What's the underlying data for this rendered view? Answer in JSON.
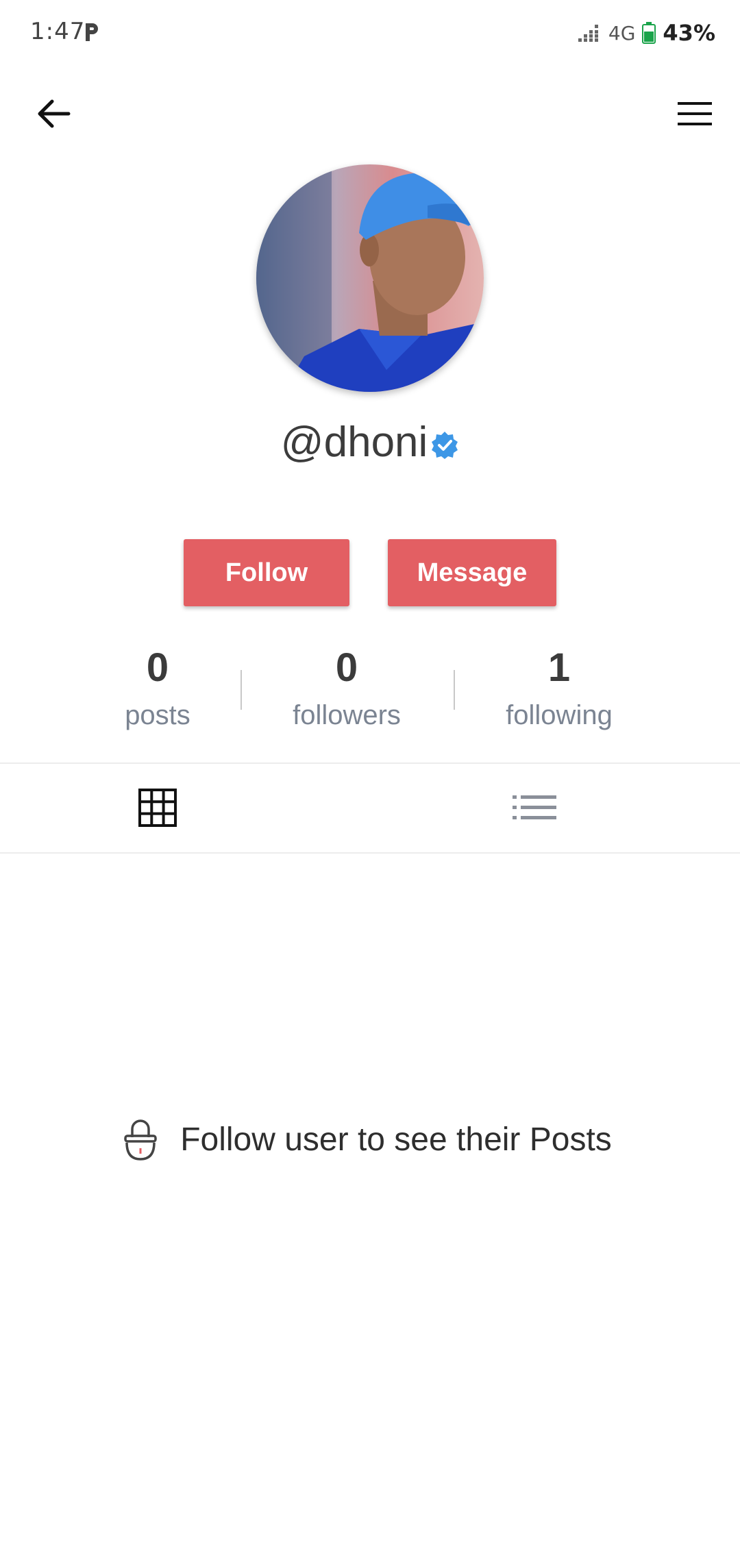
{
  "status_bar": {
    "time": "1:47",
    "network": "4G",
    "battery": "43%"
  },
  "header": {
    "back_icon": "arrow-left-icon",
    "menu_icon": "hamburger-menu-icon"
  },
  "profile": {
    "username": "@dhoni",
    "verified": true
  },
  "actions": {
    "follow_label": "Follow",
    "message_label": "Message",
    "button_color": "#e35f63"
  },
  "stats": {
    "posts": {
      "value": "0",
      "label": "posts"
    },
    "followers": {
      "value": "0",
      "label": "followers"
    },
    "following": {
      "value": "1",
      "label": "following"
    }
  },
  "tabs": [
    {
      "icon": "grid-icon",
      "active": true
    },
    {
      "icon": "list-icon",
      "active": false
    }
  ],
  "empty_state": {
    "icon": "lock-icon",
    "message": "Follow user to see their Posts"
  }
}
